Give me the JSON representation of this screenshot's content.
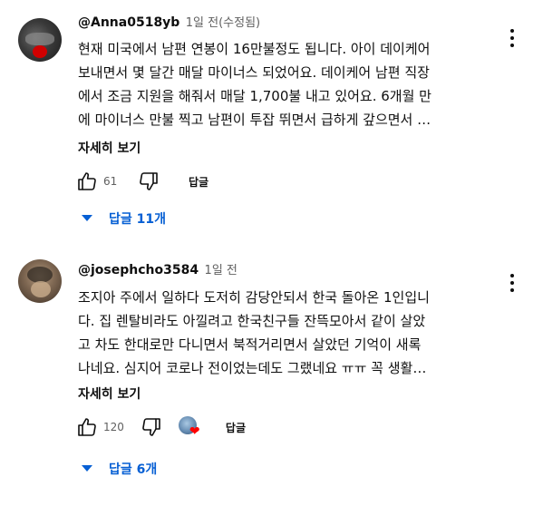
{
  "comments": [
    {
      "author": "@Anna0518yb",
      "meta": "1일 전(수정됨)",
      "lines": [
        "현재 미국에서 남편 연봉이 16만불정도 됩니다. 아이 데이케어",
        "보내면서 몇 달간 매달 마이너스 되었어요. 데이케어 남편 직장",
        "에서 조금 지원을 해줘서 매달 1,700불 내고 있어요. 6개월 만",
        "에 마이너스 만불 찍고 남편이 투잡 뛰면서 급하게 갚으면서 …"
      ],
      "more_label": "자세히 보기",
      "likes": "61",
      "reply_label": "답글",
      "replies_label": "답글 11개"
    },
    {
      "author": "@josephcho3584",
      "meta": "1일 전",
      "lines": [
        "조지아 주에서 일하다 도저히 감당안되서 한국 돌아온 1인입니",
        "다. 집 렌탈비라도 아낄려고 한국친구들 잔뜩모아서 같이 살았",
        "고 차도 한대로만 다니면서 북적거리면서 살았던 기억이 새록",
        "나네요. 심지어 코로나 전이었는데도 그랬네요 ㅠㅠ 꼭 생활…"
      ],
      "more_label": "자세히 보기",
      "likes": "120",
      "reply_label": "답글",
      "replies_label": "답글 6개"
    }
  ],
  "icons": {
    "like": "thumb-up-icon",
    "dislike": "thumb-down-icon",
    "menu": "more-vert-icon",
    "expand": "arrow-drop-down-icon",
    "creator_heart": "creator-heart-icon"
  },
  "colors": {
    "link_blue": "#065fd4",
    "heart_red": "#ff0000",
    "meta_grey": "#606060"
  }
}
